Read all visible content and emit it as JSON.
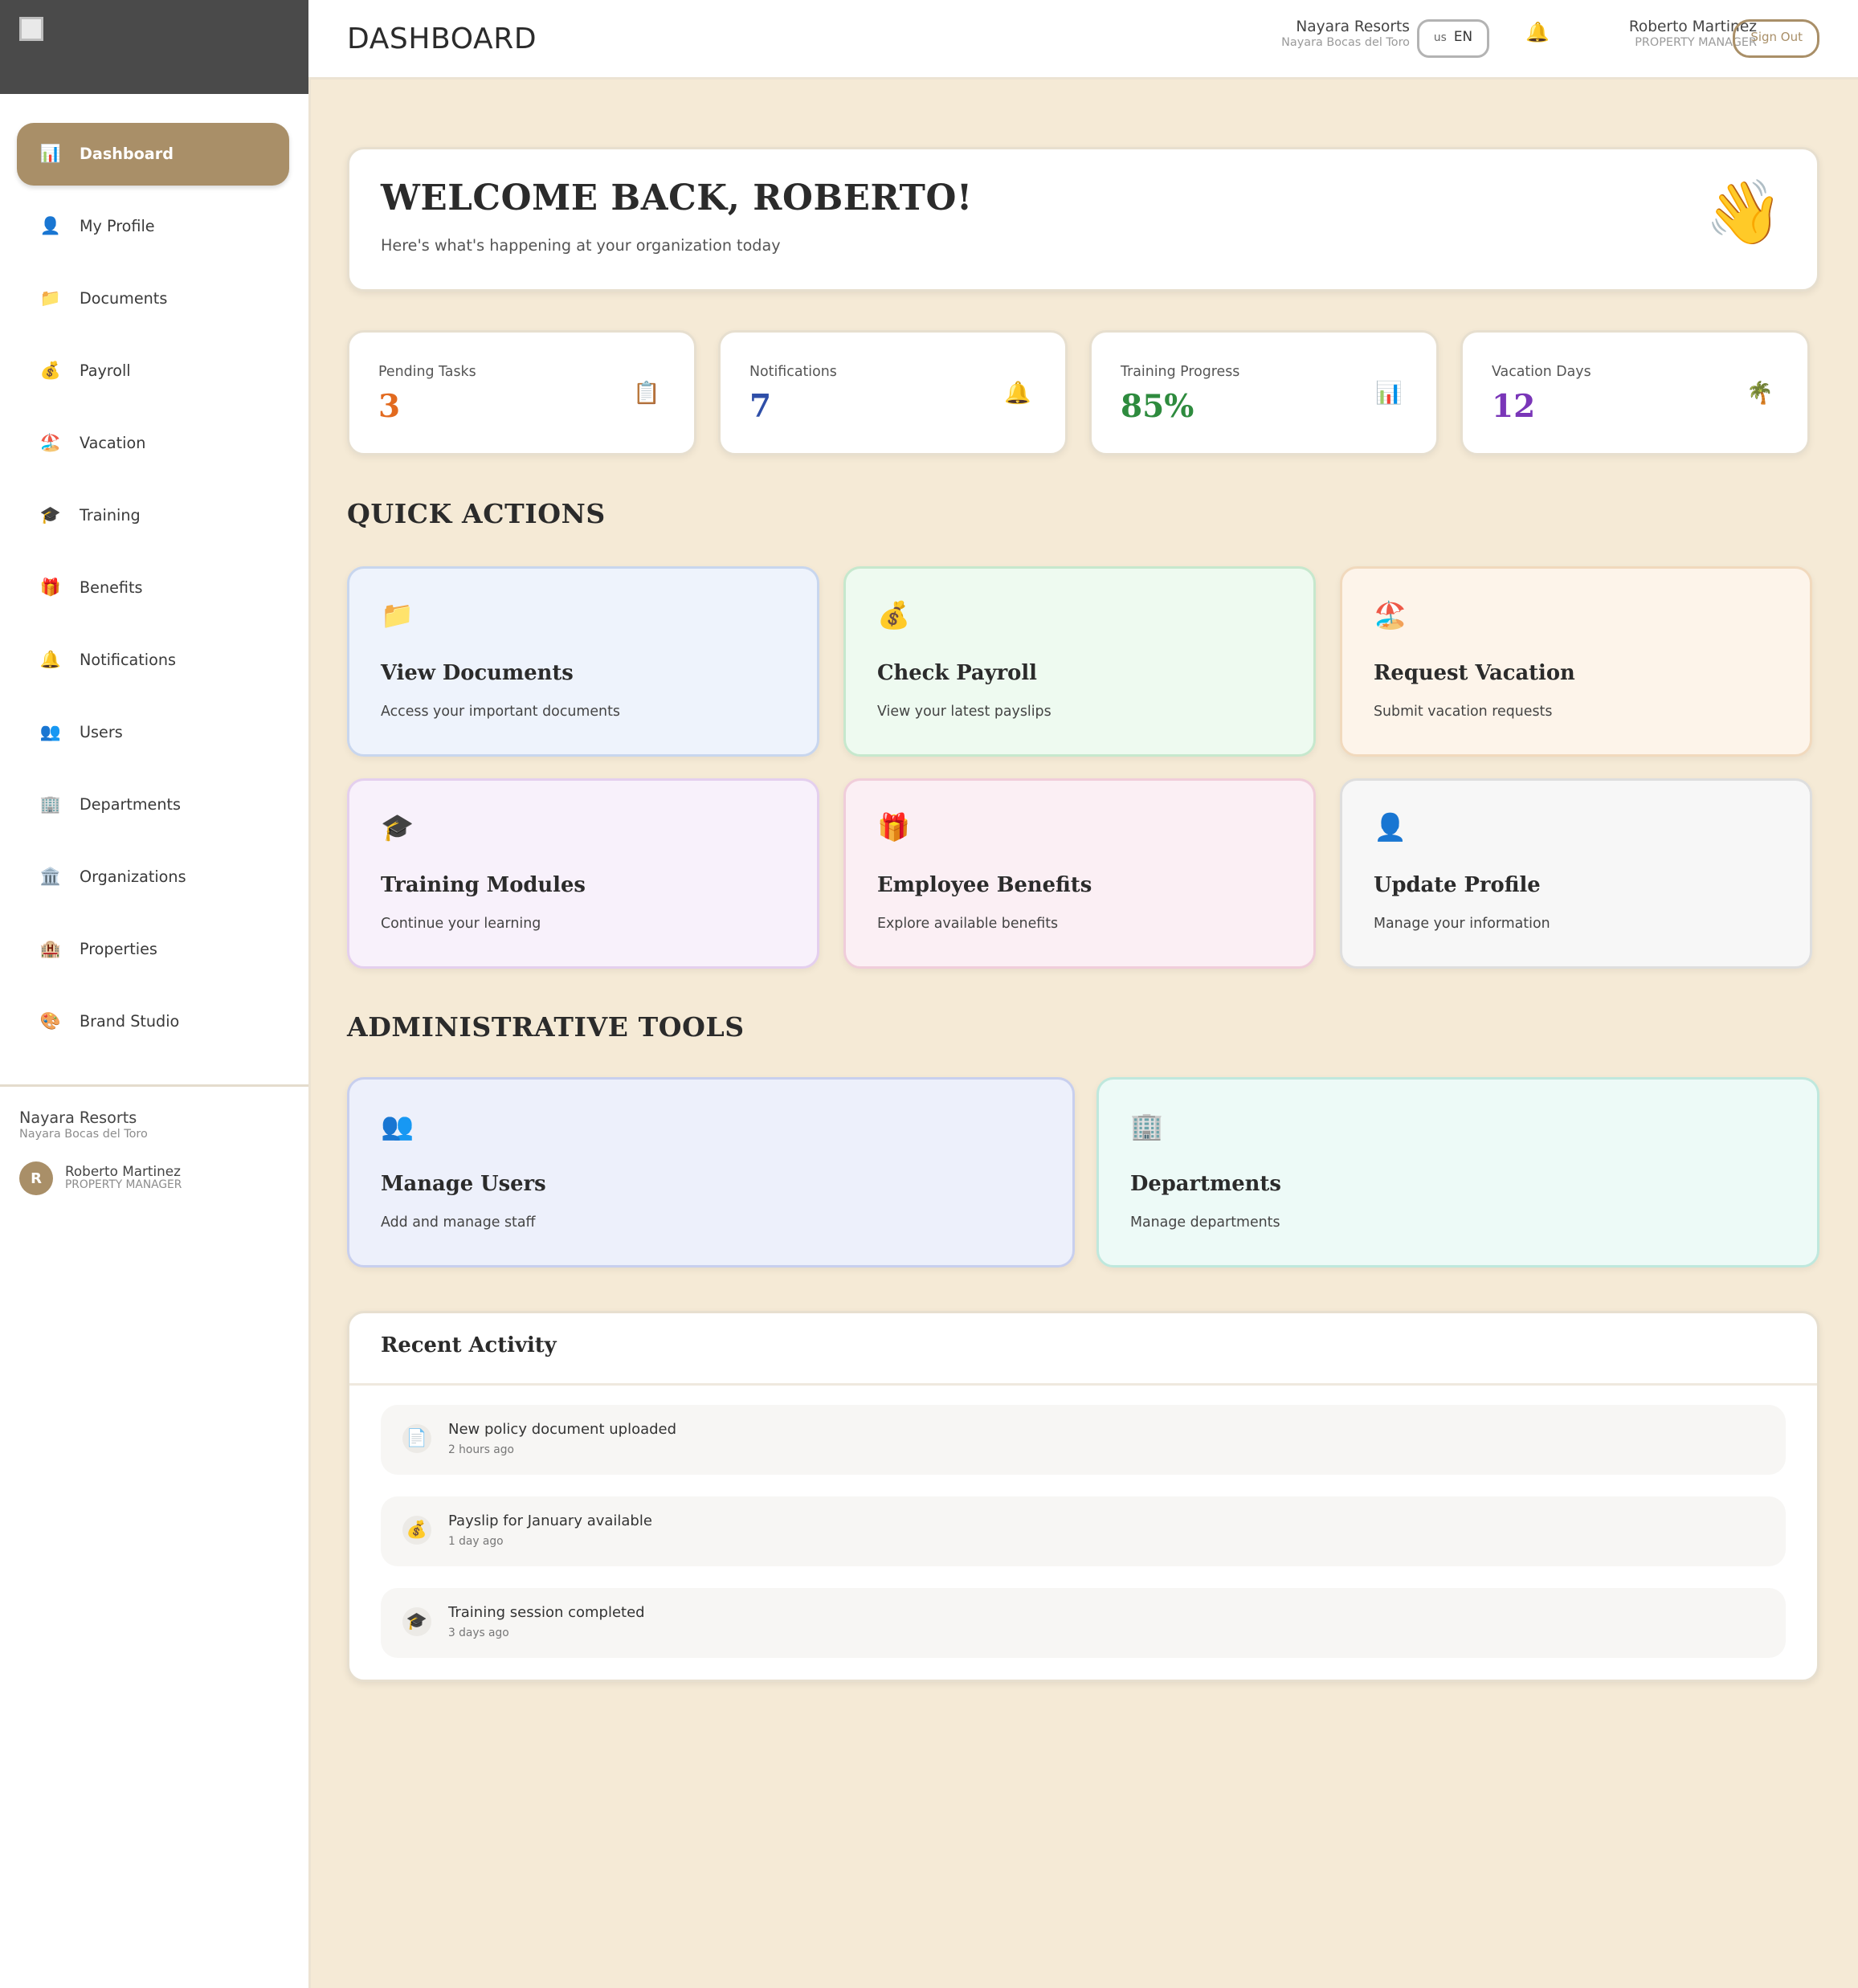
{
  "header": {
    "title": "DASHBOARD",
    "org_name": "Nayara Resorts",
    "org_sub": "Nayara Bocas del Toro",
    "language": "EN",
    "language_flag": "us",
    "user_name": "Roberto Martinez",
    "user_role": "PROPERTY MANAGER",
    "sign_out": "Sign Out"
  },
  "sidebar": {
    "items": [
      {
        "label": "Dashboard",
        "icon": "📊"
      },
      {
        "label": "My Profile",
        "icon": "👤"
      },
      {
        "label": "Documents",
        "icon": "📁"
      },
      {
        "label": "Payroll",
        "icon": "💰"
      },
      {
        "label": "Vacation",
        "icon": "🏖️"
      },
      {
        "label": "Training",
        "icon": "🎓"
      },
      {
        "label": "Benefits",
        "icon": "🎁"
      },
      {
        "label": "Notifications",
        "icon": "🔔"
      },
      {
        "label": "Users",
        "icon": "👥"
      },
      {
        "label": "Departments",
        "icon": "🏢"
      },
      {
        "label": "Organizations",
        "icon": "🏛️"
      },
      {
        "label": "Properties",
        "icon": "🏨"
      },
      {
        "label": "Brand Studio",
        "icon": "🎨"
      }
    ],
    "footer": {
      "org_name": "Nayara Resorts",
      "org_sub": "Nayara Bocas del Toro",
      "avatar_initial": "R",
      "user_name": "Roberto Martinez",
      "user_role": "PROPERTY MANAGER"
    }
  },
  "welcome": {
    "title": "WELCOME BACK, ROBERTO!",
    "subtitle": "Here's what's happening at your organization today",
    "icon": "👋"
  },
  "stats": [
    {
      "label": "Pending Tasks",
      "value": "3",
      "icon": "📋",
      "color": "#e26a1f"
    },
    {
      "label": "Notifications",
      "value": "7",
      "icon": "🔔",
      "color": "#2f4fa8"
    },
    {
      "label": "Training Progress",
      "value": "85%",
      "icon": "📊",
      "color": "#2e8b3e"
    },
    {
      "label": "Vacation Days",
      "value": "12",
      "icon": "🌴",
      "color": "#7a36b8"
    }
  ],
  "quick_actions": {
    "title": "QUICK ACTIONS",
    "items": [
      {
        "title": "View Documents",
        "desc": "Access your important documents",
        "icon": "📁",
        "bg": "#eef3fc",
        "border": "#c8d6ee"
      },
      {
        "title": "Check Payroll",
        "desc": "View your latest payslips",
        "icon": "💰",
        "bg": "#eefaf0",
        "border": "#c6e8cd"
      },
      {
        "title": "Request Vacation",
        "desc": "Submit vacation requests",
        "icon": "🏖️",
        "bg": "#fdf4ea",
        "border": "#f1d9bd"
      },
      {
        "title": "Training Modules",
        "desc": "Continue your learning",
        "icon": "🎓",
        "bg": "#f8f1fb",
        "border": "#e4cfee"
      },
      {
        "title": "Employee Benefits",
        "desc": "Explore available benefits",
        "icon": "🎁",
        "bg": "#fbeff4",
        "border": "#f0cdda"
      },
      {
        "title": "Update Profile",
        "desc": "Manage your information",
        "icon": "👤",
        "bg": "#f7f7f7",
        "border": "#dedede"
      }
    ]
  },
  "admin_tools": {
    "title": "ADMINISTRATIVE TOOLS",
    "items": [
      {
        "title": "Manage Users",
        "desc": "Add and manage staff",
        "icon": "👥",
        "bg": "#edf0fb",
        "border": "#c8cfee"
      },
      {
        "title": "Departments",
        "desc": "Manage departments",
        "icon": "🏢",
        "bg": "#edfaf7",
        "border": "#bfe8dd"
      }
    ]
  },
  "activity": {
    "title": "Recent Activity",
    "items": [
      {
        "text": "New policy document uploaded",
        "time": "2 hours ago",
        "icon": "📄"
      },
      {
        "text": "Payslip for January available",
        "time": "1 day ago",
        "icon": "💰"
      },
      {
        "text": "Training session completed",
        "time": "3 days ago",
        "icon": "🎓"
      }
    ]
  }
}
